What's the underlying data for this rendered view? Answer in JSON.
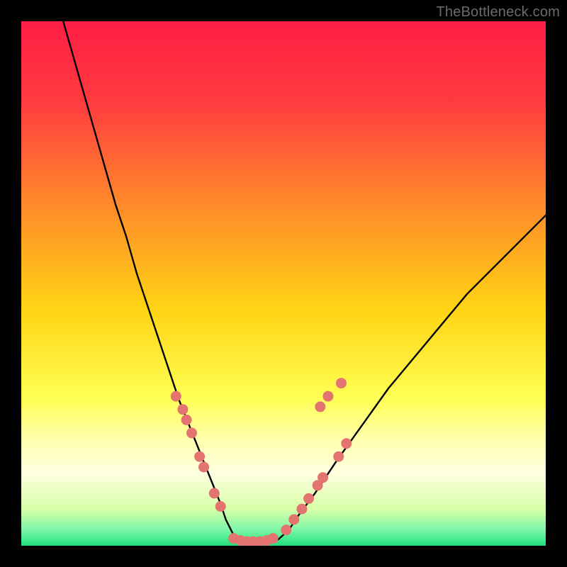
{
  "watermark": "TheBottleneck.com",
  "chart_data": {
    "type": "line",
    "title": "",
    "xlabel": "",
    "ylabel": "",
    "xlim": [
      0,
      100
    ],
    "ylim": [
      0,
      100
    ],
    "legend": false,
    "grid": false,
    "gradient_stops": [
      {
        "pos": 0.0,
        "color": "#ff1f45"
      },
      {
        "pos": 0.15,
        "color": "#ff3a3f"
      },
      {
        "pos": 0.35,
        "color": "#ff8a2a"
      },
      {
        "pos": 0.55,
        "color": "#ffd414"
      },
      {
        "pos": 0.72,
        "color": "#ffff55"
      },
      {
        "pos": 0.8,
        "color": "#ffffb0"
      },
      {
        "pos": 0.86,
        "color": "#ffffe0"
      },
      {
        "pos": 0.93,
        "color": "#d8ffa8"
      },
      {
        "pos": 0.97,
        "color": "#7cf7a8"
      },
      {
        "pos": 1.0,
        "color": "#1fe079"
      }
    ],
    "series": [
      {
        "name": "bottleneck-curve-left",
        "stroke": "#000000",
        "x": [
          8,
          10,
          12,
          14,
          16,
          18,
          20,
          22,
          24,
          26,
          28,
          30,
          32,
          34,
          36,
          38,
          39,
          40,
          41
        ],
        "y": [
          100,
          93,
          86,
          79,
          72,
          65,
          59,
          52,
          46,
          40,
          34,
          28,
          23,
          18,
          13,
          8,
          5,
          3,
          1
        ]
      },
      {
        "name": "bottleneck-curve-flat",
        "stroke": "#000000",
        "x": [
          41,
          42,
          43,
          44,
          45,
          46,
          47,
          48,
          49
        ],
        "y": [
          1,
          0.5,
          0.3,
          0.2,
          0.2,
          0.3,
          0.5,
          0.8,
          1.2
        ]
      },
      {
        "name": "bottleneck-curve-right",
        "stroke": "#000000",
        "x": [
          49,
          51,
          53,
          56,
          60,
          65,
          70,
          75,
          80,
          85,
          90,
          95,
          100
        ],
        "y": [
          1.2,
          3,
          6,
          10,
          16,
          23,
          30,
          36,
          42,
          48,
          53,
          58,
          63
        ]
      },
      {
        "name": "markers-left",
        "type": "scatter",
        "color": "#e3746f",
        "x": [
          29.5,
          30.8,
          31.5,
          32.5,
          34.0,
          34.8,
          36.8,
          38.0
        ],
        "y": [
          28.5,
          26.0,
          24.0,
          21.5,
          17.0,
          15.0,
          10.0,
          7.5
        ]
      },
      {
        "name": "markers-bottom",
        "type": "scatter",
        "color": "#e3746f",
        "x": [
          40.5,
          41.8,
          43.0,
          44.2,
          45.5,
          46.8,
          48.0
        ],
        "y": [
          1.4,
          1.0,
          0.8,
          0.8,
          0.8,
          1.0,
          1.4
        ]
      },
      {
        "name": "markers-right",
        "type": "scatter",
        "color": "#e3746f",
        "x": [
          50.5,
          52.0,
          53.5,
          54.8,
          56.5,
          57.5,
          60.5,
          62.0
        ],
        "y": [
          3.0,
          5.0,
          7.0,
          9.0,
          11.5,
          13.0,
          17.0,
          19.5
        ]
      },
      {
        "name": "markers-right-upper",
        "type": "scatter",
        "color": "#e3746f",
        "x": [
          57.0,
          58.5,
          61.0
        ],
        "y": [
          26.5,
          28.5,
          31.0
        ]
      }
    ]
  }
}
